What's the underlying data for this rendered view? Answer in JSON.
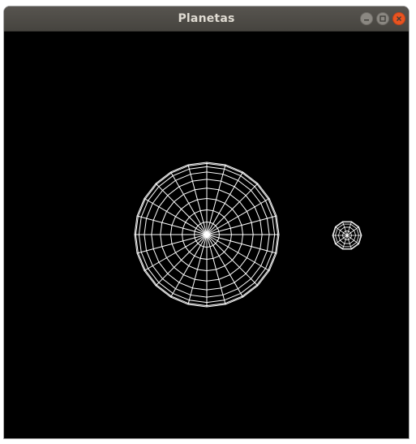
{
  "window": {
    "title": "Planetas"
  },
  "controls": {
    "minimize_icon": "minimize-icon",
    "maximize_icon": "maximize-icon",
    "close_icon": "close-icon"
  },
  "scene": {
    "background_color": "#000000",
    "wireframe_color": "#ffffff",
    "bodies": [
      {
        "name": "planet-large",
        "rings": 9,
        "meridians": 24
      },
      {
        "name": "planet-small",
        "rings": 5,
        "meridians": 10
      }
    ]
  }
}
